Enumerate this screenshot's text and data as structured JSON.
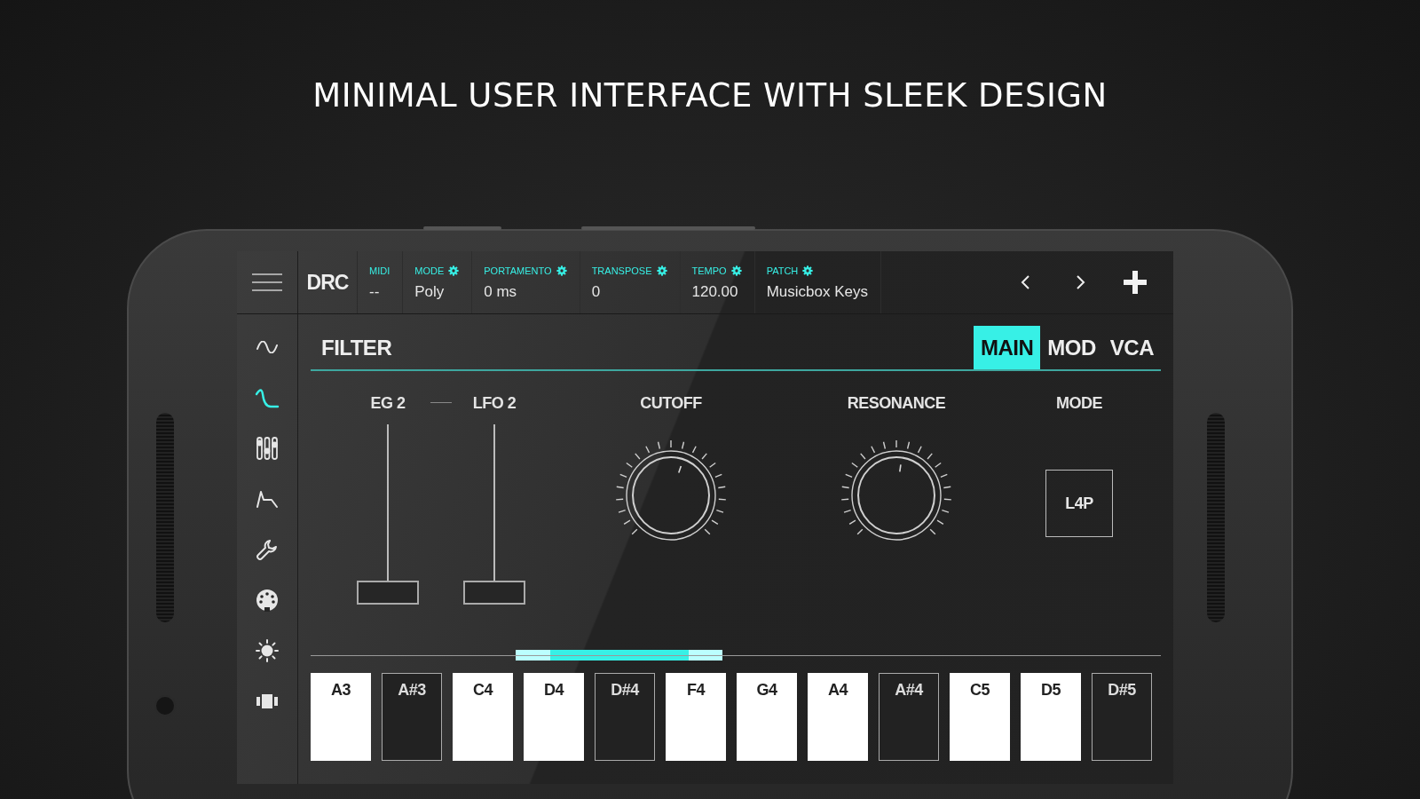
{
  "headline": "MINIMAL USER INTERFACE WITH SLEEK DESIGN",
  "top_bar": {
    "logo": "DRC",
    "fields": [
      {
        "label": "MIDI",
        "value": "--",
        "settings": false
      },
      {
        "label": "MODE",
        "value": "Poly",
        "settings": true
      },
      {
        "label": "PORTAMENTO",
        "value": "0 ms",
        "settings": true
      },
      {
        "label": "TRANSPOSE",
        "value": "0",
        "settings": true
      },
      {
        "label": "TEMPO",
        "value": "120.00",
        "settings": true
      },
      {
        "label": "PATCH",
        "value": "Musicbox Keys",
        "settings": true
      }
    ]
  },
  "sidebar": {
    "items": [
      {
        "selected": false
      },
      {
        "selected": true
      },
      {
        "selected": false
      },
      {
        "selected": false
      },
      {
        "selected": false
      },
      {
        "selected": false
      },
      {
        "selected": false
      },
      {
        "selected": false
      }
    ]
  },
  "panel": {
    "title": "FILTER",
    "tabs": [
      {
        "label": "MAIN",
        "selected": true
      },
      {
        "label": "MOD",
        "selected": false
      },
      {
        "label": "VCA",
        "selected": false
      }
    ],
    "controls": [
      {
        "kind": "slider",
        "label": "EG 2",
        "level": 0
      },
      {
        "kind": "slider",
        "label": "LFO 2",
        "level": 0
      },
      {
        "kind": "knob",
        "label": "CUTOFF",
        "level": 0.57
      },
      {
        "kind": "knob",
        "label": "RESONANCE",
        "level": 0.53
      },
      {
        "kind": "button",
        "label": "MODE",
        "value": "L4P"
      }
    ]
  },
  "keyboard": {
    "keys": [
      {
        "note": "A3",
        "kind": "white"
      },
      {
        "note": "A#3",
        "kind": "black"
      },
      {
        "note": "C4",
        "kind": "white"
      },
      {
        "note": "D4",
        "kind": "white"
      },
      {
        "note": "D#4",
        "kind": "black"
      },
      {
        "note": "F4",
        "kind": "white"
      },
      {
        "note": "G4",
        "kind": "white"
      },
      {
        "note": "A4",
        "kind": "white"
      },
      {
        "note": "A#4",
        "kind": "black"
      },
      {
        "note": "C5",
        "kind": "white"
      },
      {
        "note": "D5",
        "kind": "white"
      },
      {
        "note": "D#5",
        "kind": "black"
      }
    ]
  }
}
